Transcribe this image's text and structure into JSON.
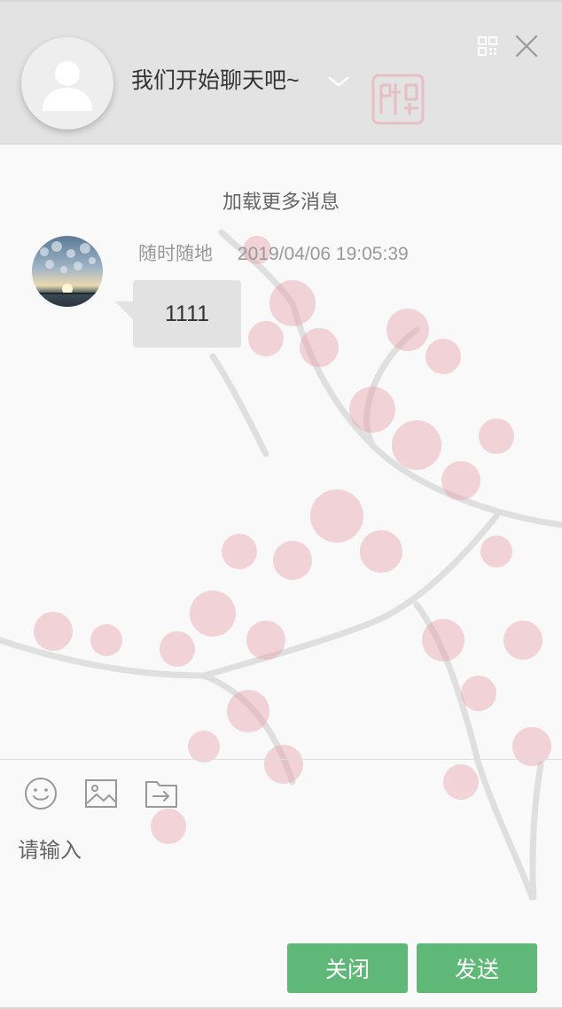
{
  "header": {
    "title": "我们开始聊天吧~",
    "avatar_icon": "user-silhouette-icon",
    "seal_icon": "red-seal-stamp",
    "qr_icon": "qr-code-icon",
    "close_icon": "close-icon"
  },
  "chat": {
    "load_more": "加载更多消息",
    "messages": [
      {
        "sender": "随时随地",
        "time": "2019/04/06 19:05:39",
        "text": "1111",
        "avatar_icon": "sunset-sky-avatar"
      }
    ]
  },
  "toolbar": {
    "emoji_icon": "smiley-icon",
    "image_icon": "image-icon",
    "file_icon": "file-transfer-icon"
  },
  "input": {
    "placeholder": "请输入",
    "value": ""
  },
  "buttons": {
    "close_label": "关闭",
    "send_label": "发送"
  },
  "colors": {
    "header_bg": "#e3e3e3",
    "accent": "#5fb878",
    "bubble_bg": "#e2e2e2",
    "blossom": "#e8a3ad"
  }
}
